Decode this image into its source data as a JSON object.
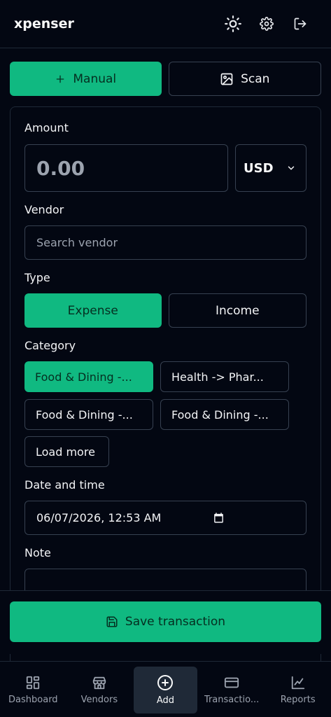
{
  "header": {
    "brand": "xpenser",
    "icons": [
      "sun-icon",
      "gear-icon",
      "logout-icon"
    ]
  },
  "mode_tabs": [
    {
      "label": "Manual",
      "icon": "plus-icon",
      "active": true
    },
    {
      "label": "Scan",
      "icon": "image-scan-icon",
      "active": false
    }
  ],
  "form": {
    "amount_label": "Amount",
    "amount_placeholder": "0.00",
    "currency": "USD",
    "vendor_label": "Vendor",
    "vendor_placeholder": "Search vendor",
    "type_label": "Type",
    "type_options": [
      {
        "label": "Expense",
        "active": true
      },
      {
        "label": "Income",
        "active": false
      }
    ],
    "category_label": "Category",
    "categories": [
      {
        "label": "Food & Dining -...",
        "active": true
      },
      {
        "label": "Health -> Phar...",
        "active": false
      },
      {
        "label": "Food & Dining -...",
        "active": false
      },
      {
        "label": "Food & Dining -...",
        "active": false
      }
    ],
    "load_more": "Load more",
    "date_label": "Date and time",
    "date_value": "06/07/2026, 12:53 AM",
    "note_label": "Note"
  },
  "save_button": "Save transaction",
  "bottom_nav": [
    {
      "label": "Dashboard",
      "icon": "dashboard-icon",
      "active": false
    },
    {
      "label": "Vendors",
      "icon": "store-icon",
      "active": false
    },
    {
      "label": "Add",
      "icon": "plus-circle-icon",
      "active": true
    },
    {
      "label": "Transactio...",
      "icon": "credit-card-icon",
      "active": false
    },
    {
      "label": "Reports",
      "icon": "chart-line-icon",
      "active": false
    }
  ],
  "colors": {
    "accent": "#10b981",
    "background": "#030712",
    "border": "#374151"
  }
}
